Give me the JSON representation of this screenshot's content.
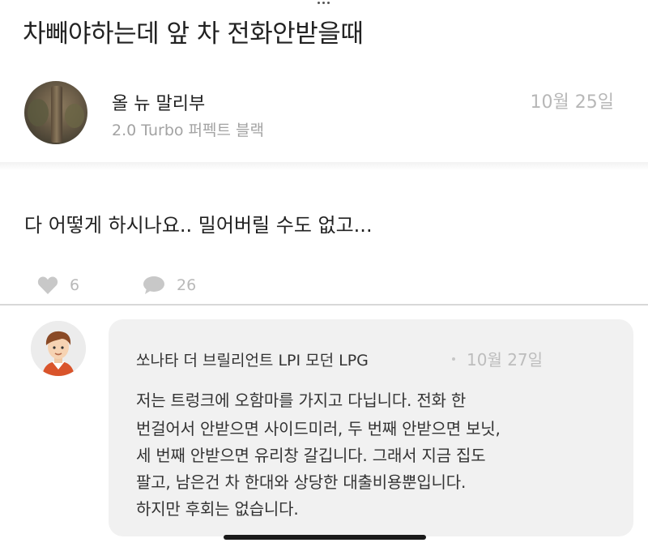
{
  "post": {
    "title": "차빼야하는데 앞 차 전화안받을때",
    "author": "올 뉴 말리부",
    "author_car": "2.0 Turbo 퍼펙트 블랙",
    "date": "10월 25일",
    "body": "다 어떻게 하시나요.. 밀어버릴 수도 없고...",
    "likes": "6",
    "comments": "26",
    "like_icon": "heart-icon",
    "comment_icon": "speech-bubble-icon"
  },
  "comment": {
    "author": "쏘나타 더 브릴리언트 LPI 모던 LPG",
    "date": "10월 27일",
    "lines": [
      "저는 트렁크에 오함마를 가지고 다닙니다. 전화 한",
      "번걸어서 안받으면 사이드미러, 두 번째 안받으면 보닛,",
      "세 번째 안받으면 유리창 갈깁니다. 그래서 지금 집도",
      "팔고, 남은건 차 한대와 상당한 대출비용뿐입니다.",
      "하지만 후회는 없습니다."
    ]
  },
  "colors": {
    "muted_text": "#b7b7b7",
    "bubble_bg": "#f1f1f1",
    "icon_gray": "#c8c8c8"
  }
}
